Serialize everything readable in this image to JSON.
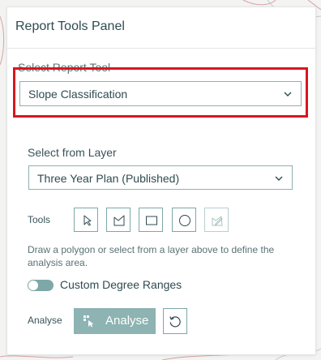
{
  "panel": {
    "title": "Report Tools Panel"
  },
  "report_tool": {
    "label": "Select Report Tool",
    "selected": "Slope Classification"
  },
  "layer": {
    "label": "Select from Layer",
    "selected": "Three Year Plan (Published)"
  },
  "tools": {
    "label": "Tools",
    "buttons": [
      {
        "icon": "select-pointer-icon",
        "enabled": true
      },
      {
        "icon": "polygon-icon",
        "enabled": true
      },
      {
        "icon": "rectangle-icon",
        "enabled": true
      },
      {
        "icon": "circle-icon",
        "enabled": true
      },
      {
        "icon": "edit-shape-icon",
        "enabled": false
      }
    ],
    "help": "Draw a polygon or select from a layer above to define the analysis area."
  },
  "degree_toggle": {
    "label": "Custom Degree Ranges",
    "on": false
  },
  "analyse": {
    "label": "Analyse",
    "button_label": "Analyse"
  },
  "colors": {
    "accent": "#8db3b2",
    "border": "#7ea7a7",
    "highlight": "#d8161e",
    "text": "#2f4b50"
  }
}
